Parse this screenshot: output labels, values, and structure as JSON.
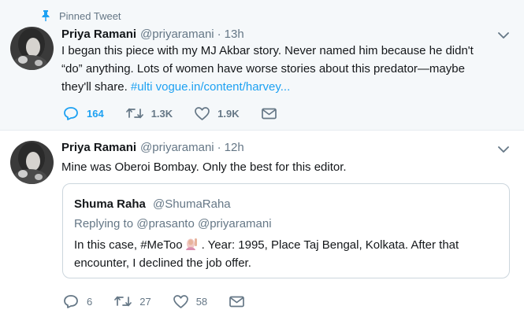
{
  "pinned_label": "Pinned Tweet",
  "tweets": [
    {
      "name": "Priya Ramani",
      "handle": "@priyaramani",
      "separator": "·",
      "time": "13h",
      "text_lines": [
        "I began this piece with my MJ Akbar story. Never named him because he didn't",
        "“do” anything. Lots of women have worse stories about this predator—maybe",
        "they'll share."
      ],
      "links": "#ulti vogue.in/content/harvey...",
      "replies": "164",
      "retweets": "1.3K",
      "likes": "1.9K"
    },
    {
      "name": "Priya Ramani",
      "handle": "@priyaramani",
      "separator": "·",
      "time": "12h",
      "text": "Mine was Oberoi Bombay. Only the best for this editor.",
      "quoted": {
        "name": "Shuma Raha",
        "handle": "@ShumaRaha",
        "replying_to": "Replying to @prasanto @priyaramani",
        "text_before_emoji": "In this case, #MeToo",
        "text_after_emoji": ". Year: 1995, Place Taj Bengal, Kolkata. After that",
        "text_line2": "encounter, I declined the job offer.",
        "emoji": "woman-raising-hand-emoji"
      },
      "replies": "6",
      "retweets": "27",
      "likes": "58"
    }
  ],
  "colors": {
    "accent": "#1da1f2",
    "muted": "#657786",
    "pinned_bg": "#f5f8fa",
    "border": "#e6ecf0"
  },
  "icons": [
    "pin-icon",
    "chevron-down-icon",
    "reply-icon",
    "retweet-icon",
    "like-icon",
    "dm-icon"
  ]
}
